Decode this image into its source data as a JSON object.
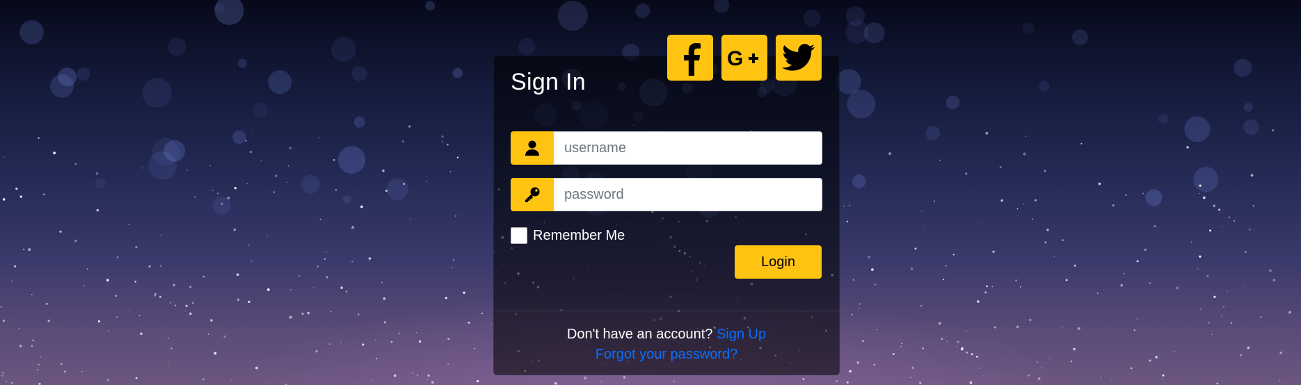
{
  "card": {
    "title": "Sign In"
  },
  "social": [
    {
      "name": "facebook",
      "icon": "facebook-icon"
    },
    {
      "name": "google-plus",
      "icon": "google-plus-icon"
    },
    {
      "name": "twitter",
      "icon": "twitter-icon"
    }
  ],
  "form": {
    "username_placeholder": "username",
    "username_value": "",
    "password_placeholder": "password",
    "password_value": "",
    "remember_label": "Remember Me",
    "remember_checked": false,
    "login_label": "Login"
  },
  "footer": {
    "prompt": "Don't have an account?",
    "signup_link": "Sign Up",
    "forgot_link": "Forgot your password?"
  },
  "colors": {
    "accent": "#FFC312",
    "link": "#0d6efd",
    "card_bg": "rgba(0,0,0,0.55)"
  }
}
